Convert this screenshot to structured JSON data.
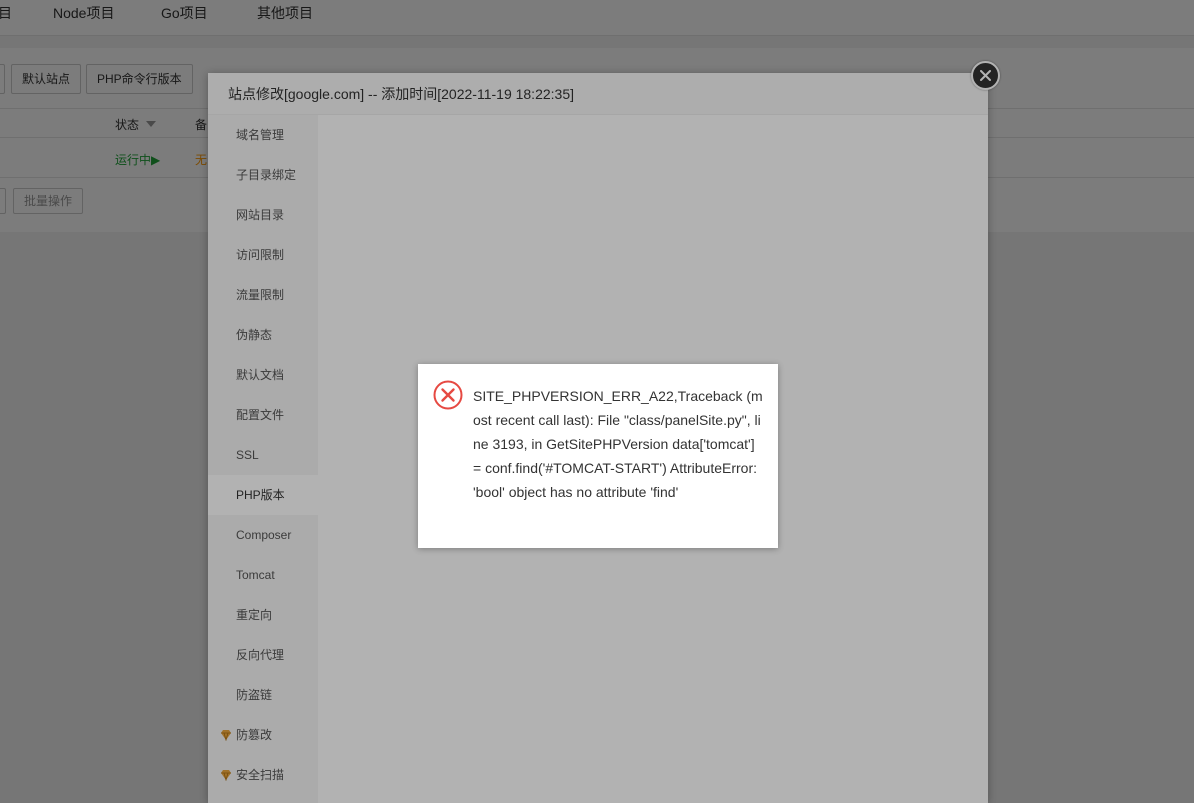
{
  "topnav": {
    "items": [
      "目",
      "Node项目",
      "Go项目",
      "其他项目"
    ]
  },
  "toolbar": {
    "default_site_label": "默认站点",
    "php_cli_label": "PHP命令行版本"
  },
  "table": {
    "header_status": "状态",
    "header_note": "备",
    "row_status": "运行中▶",
    "row_note": "无"
  },
  "footer": {
    "batch_label": "批量操作"
  },
  "modal": {
    "title": "站点修改[google.com] -- 添加时间[2022-11-19 18:22:35]",
    "sidebar_items": [
      {
        "label": "域名管理",
        "icon": ""
      },
      {
        "label": "子目录绑定",
        "icon": ""
      },
      {
        "label": "网站目录",
        "icon": ""
      },
      {
        "label": "访问限制",
        "icon": ""
      },
      {
        "label": "流量限制",
        "icon": ""
      },
      {
        "label": "伪静态",
        "icon": ""
      },
      {
        "label": "默认文档",
        "icon": ""
      },
      {
        "label": "配置文件",
        "icon": ""
      },
      {
        "label": "SSL",
        "icon": ""
      },
      {
        "label": "PHP版本",
        "icon": "",
        "active": true
      },
      {
        "label": "Composer",
        "icon": ""
      },
      {
        "label": "Tomcat",
        "icon": ""
      },
      {
        "label": "重定向",
        "icon": ""
      },
      {
        "label": "反向代理",
        "icon": ""
      },
      {
        "label": "防盗链",
        "icon": ""
      },
      {
        "label": "防篡改",
        "icon": "gem-icon"
      },
      {
        "label": "安全扫描",
        "icon": "gem-icon"
      }
    ],
    "close_icon": "close-icon"
  },
  "error_dialog": {
    "icon": "error-circle-icon",
    "message": "SITE_PHPVERSION_ERR_A22,Traceback (most recent call last): File \"class/panelSite.py\", line 3193, in GetSitePHPVersion data['tomcat'] = conf.find('#TOMCAT-START') AttributeError: 'bool' object has no attribute 'find'"
  },
  "colors": {
    "running": "#20a53a",
    "note": "#ff9900",
    "error": "#e64942",
    "gem": "#e6a23c"
  }
}
